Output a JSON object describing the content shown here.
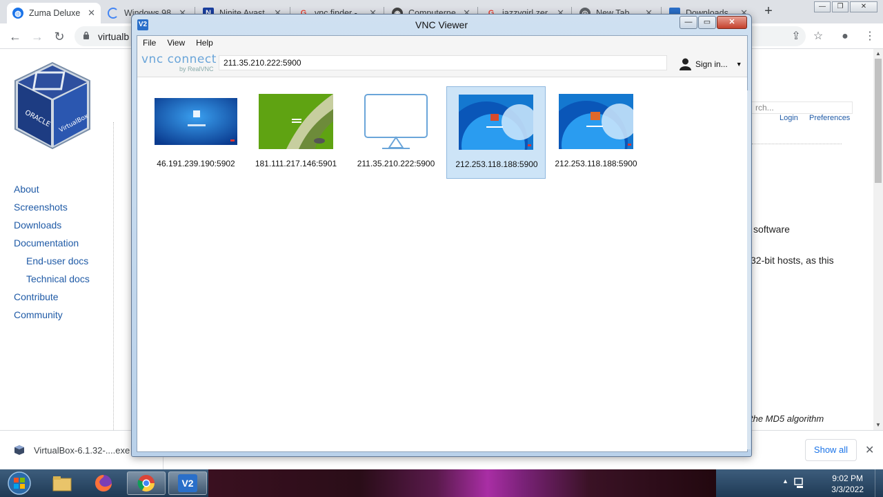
{
  "browser": {
    "tabs": [
      {
        "title": "Zuma Deluxe",
        "favicon_color": "#1a73e8"
      },
      {
        "title": "Windows 98",
        "favicon_color": "#4285f4"
      },
      {
        "title": "Ninite Avast",
        "favicon_color": "#1a3fa0"
      },
      {
        "title": "vnc finder - ",
        "favicon_color": "#ea4335"
      },
      {
        "title": "Computerne",
        "favicon_color": "#444444"
      },
      {
        "title": "jazzygirl zer",
        "favicon_color": "#ea4335"
      },
      {
        "title": "New Tab",
        "favicon_color": "#5f6368"
      },
      {
        "title": "Downloads",
        "favicon_color": "#2a6fc9"
      }
    ],
    "url": "virtualb"
  },
  "page": {
    "nav": [
      "About",
      "Screenshots",
      "Downloads",
      "Documentation",
      "End-user docs",
      "Technical docs",
      "Contribute",
      "Community"
    ],
    "search_placeholder": "rch...",
    "login": "Login",
    "preferences": "Preferences",
    "text_software": "software",
    "text_32bit": "32-bit hosts, as this",
    "text_md5": "the MD5 algorithm"
  },
  "download": {
    "filename": "VirtualBox-6.1.32-....exe",
    "show_all": "Show all"
  },
  "vnc": {
    "title": "VNC Viewer",
    "app_icon": "V2",
    "menu": [
      "File",
      "View",
      "Help"
    ],
    "brand": "vnc connect",
    "brand_sub": "by RealVNC",
    "address": "211.35.210.222:5900",
    "signin": "Sign in...",
    "connections": [
      {
        "label": "46.191.239.190:5902",
        "thumb": "win7-login",
        "selected": false
      },
      {
        "label": "181.111.217.146:5901",
        "thumb": "green-desktop",
        "selected": false
      },
      {
        "label": "211.35.210.222:5900",
        "thumb": "monitor-placeholder",
        "selected": false
      },
      {
        "label": "212.253.118.188:5900",
        "thumb": "blue-desktop",
        "selected": true
      },
      {
        "label": "212.253.118.188:5900",
        "thumb": "blue-desktop",
        "selected": false
      }
    ]
  },
  "taskbar": {
    "clock_time": "9:02 PM",
    "clock_date": "3/3/2022"
  },
  "colors": {
    "link": "#1f5aa6",
    "selection": "#cde4f7",
    "chrome_tabstrip": "#dee1e6"
  }
}
